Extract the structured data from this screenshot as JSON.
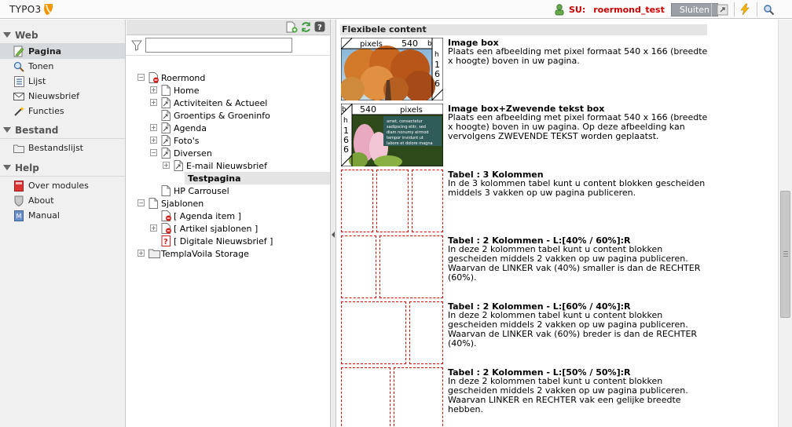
{
  "header": {
    "logo_text": "TYPO3",
    "su_label": "SU:",
    "su_user": "roermond_test",
    "logout_label": "Sluiten",
    "colors": {
      "accent": "#cc0000",
      "logo_orange": "#f49700"
    }
  },
  "modules": {
    "groups": [
      {
        "label": "Web",
        "items": [
          {
            "label": "Pagina",
            "icon": "page-edit-icon",
            "active": true
          },
          {
            "label": "Tonen",
            "icon": "magnifier-icon"
          },
          {
            "label": "Lijst",
            "icon": "list-icon"
          },
          {
            "label": "Nieuwsbrief",
            "icon": "envelope-icon"
          },
          {
            "label": "Functies",
            "icon": "wand-icon"
          }
        ]
      },
      {
        "label": "Bestand",
        "items": [
          {
            "label": "Bestandslijst",
            "icon": "folder-icon"
          }
        ]
      },
      {
        "label": "Help",
        "items": [
          {
            "label": "Over modules",
            "icon": "book-icon"
          },
          {
            "label": "About",
            "icon": "shield-icon"
          },
          {
            "label": "Manual",
            "icon": "manual-icon"
          }
        ]
      }
    ]
  },
  "tree": {
    "filter_value": "",
    "nodes": [
      {
        "label": "Roermond",
        "depth": 0,
        "toggle": "minus",
        "icon": "page-restricted"
      },
      {
        "label": "Home",
        "depth": 1,
        "toggle": "plus",
        "icon": "page"
      },
      {
        "label": "Activiteiten & Actueel",
        "depth": 1,
        "toggle": "plus",
        "icon": "page-shortcut"
      },
      {
        "label": "Groentips & Groeninfo",
        "depth": 1,
        "toggle": "none",
        "icon": "page-shortcut"
      },
      {
        "label": "Agenda",
        "depth": 1,
        "toggle": "plus",
        "icon": "page-shortcut"
      },
      {
        "label": "Foto's",
        "depth": 1,
        "toggle": "plus",
        "icon": "page-shortcut"
      },
      {
        "label": "Diversen",
        "depth": 1,
        "toggle": "minus",
        "icon": "page-shortcut"
      },
      {
        "label": "E-mail Nieuwsbrief",
        "depth": 2,
        "toggle": "plus",
        "icon": "page-shortcut"
      },
      {
        "label": "Testpagina",
        "depth": 2,
        "toggle": "none",
        "icon": "page",
        "selected": true
      },
      {
        "label": "HP Carrousel",
        "depth": 1,
        "toggle": "none",
        "icon": "page"
      },
      {
        "label": "Sjablonen",
        "depth": 0,
        "toggle": "minus",
        "icon": "page"
      },
      {
        "label": "[ Agenda item ]",
        "depth": 1,
        "toggle": "none",
        "icon": "page-restricted"
      },
      {
        "label": "[ Artikel sjablonen ]",
        "depth": 1,
        "toggle": "plus",
        "icon": "page-restricted"
      },
      {
        "label": "[ Digitale Nieuwsbrief ]",
        "depth": 1,
        "toggle": "none",
        "icon": "page-unknown"
      },
      {
        "label": "TemplaVoila Storage",
        "depth": 0,
        "toggle": "plus",
        "icon": "folder"
      }
    ]
  },
  "content": {
    "heading": "Flexibele content",
    "templates": [
      {
        "title": "Image box",
        "desc": "Plaats een afbeelding met pixel formaat 540 x 166 (breedte x hoogte) boven in uw pagina.",
        "thumb": {
          "label_b": "b",
          "label_h": "h",
          "label_pixels": "pixels",
          "width": "540",
          "height": [
            "1",
            "6",
            "6"
          ]
        }
      },
      {
        "title": "Image box+Zwevende tekst box",
        "desc": "Plaats een afbeelding met pixel formaat 540 x 166 (breedte x hoogte) boven in uw pagina. Op deze afbeelding kan vervolgens ZWEVENDE TEKST worden geplaatst.",
        "thumb": {
          "label_b": "b",
          "label_h": "h",
          "label_pixels": "pixels",
          "width": "540",
          "height": [
            "1",
            "6",
            "6"
          ]
        }
      },
      {
        "title": "Tabel : 3 Kolommen",
        "desc": "In de 3 kolommen tabel kunt u content blokken gescheiden middels 3 vakken op uw pagina publiceren."
      },
      {
        "title": "Tabel : 2 Kolommen - L:[40% / 60%]:R",
        "desc": "In deze 2 kolommen tabel kunt u content blokken gescheiden middels 2 vakken op uw pagina publiceren. Waarvan de LINKER vak (40%) smaller is dan de RECHTER (60%)."
      },
      {
        "title": "Tabel : 2 Kolommen - L:[60% / 40%]:R",
        "desc": "In deze 2 kolommen tabel kunt u content blokken gescheiden middels 2 vakken op uw pagina publiceren. Waarvan de LINKER vak (60%) breder is dan de RECHTER (40%)."
      },
      {
        "title": "Tabel : 2 Kolommen - L:[50% / 50%]:R",
        "desc": "In deze 2 kolommen tabel kunt u content blokken gescheiden middels 2 vakken op uw pagina publiceren. Waarvan LINKER en RECHTER vak een gelijke breedte hebben."
      }
    ]
  }
}
